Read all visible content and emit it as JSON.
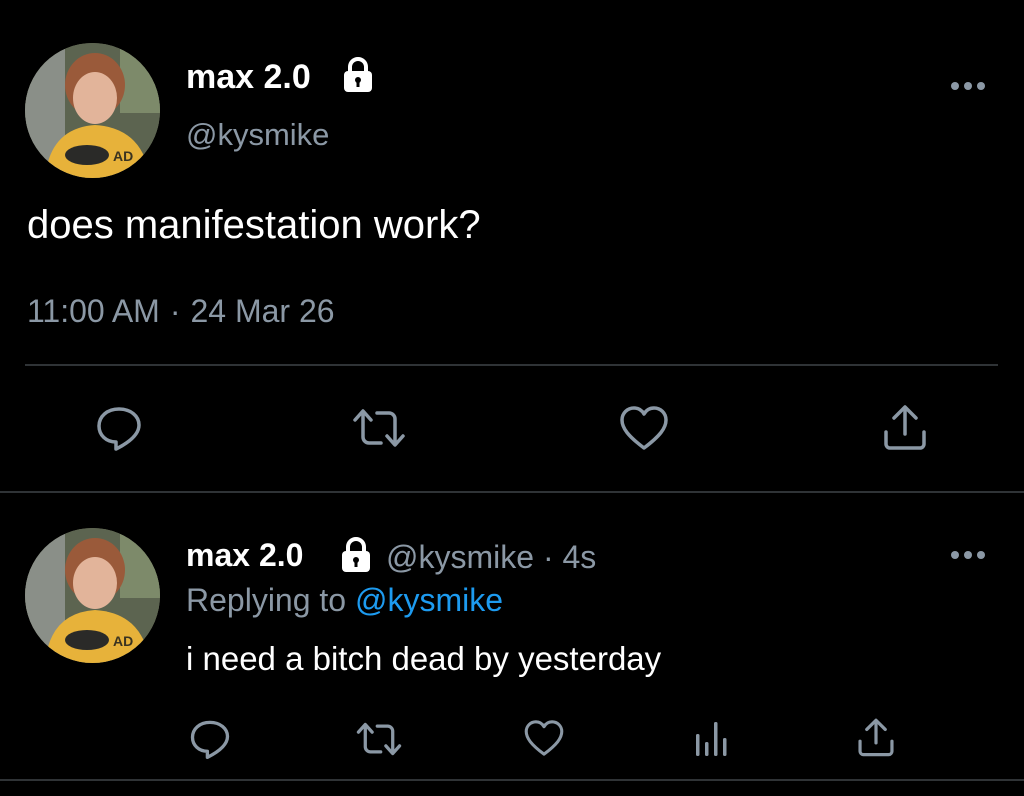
{
  "main_tweet": {
    "display_name": "max 2.0",
    "handle": "@kysmike",
    "text": "does manifestation work?",
    "time": "11:00 AM",
    "separator": "·",
    "date": "24 Mar 26"
  },
  "reply_tweet": {
    "display_name": "max 2.0",
    "handle": "@kysmike",
    "separator": "·",
    "age": "4s",
    "replying_prefix": "Replying to",
    "replying_to": "@kysmike",
    "text": "i need a bitch dead by yesterday"
  },
  "icons": {
    "lock": "lock-icon",
    "more": "more-options-icon",
    "reply": "reply-icon",
    "retweet": "retweet-icon",
    "like": "heart-icon",
    "views": "analytics-icon",
    "share": "share-icon"
  },
  "colors": {
    "background": "#000000",
    "primary_text": "#ffffff",
    "secondary_text": "#8b98a5",
    "link": "#1d9bf0",
    "divider": "#2f3336"
  }
}
